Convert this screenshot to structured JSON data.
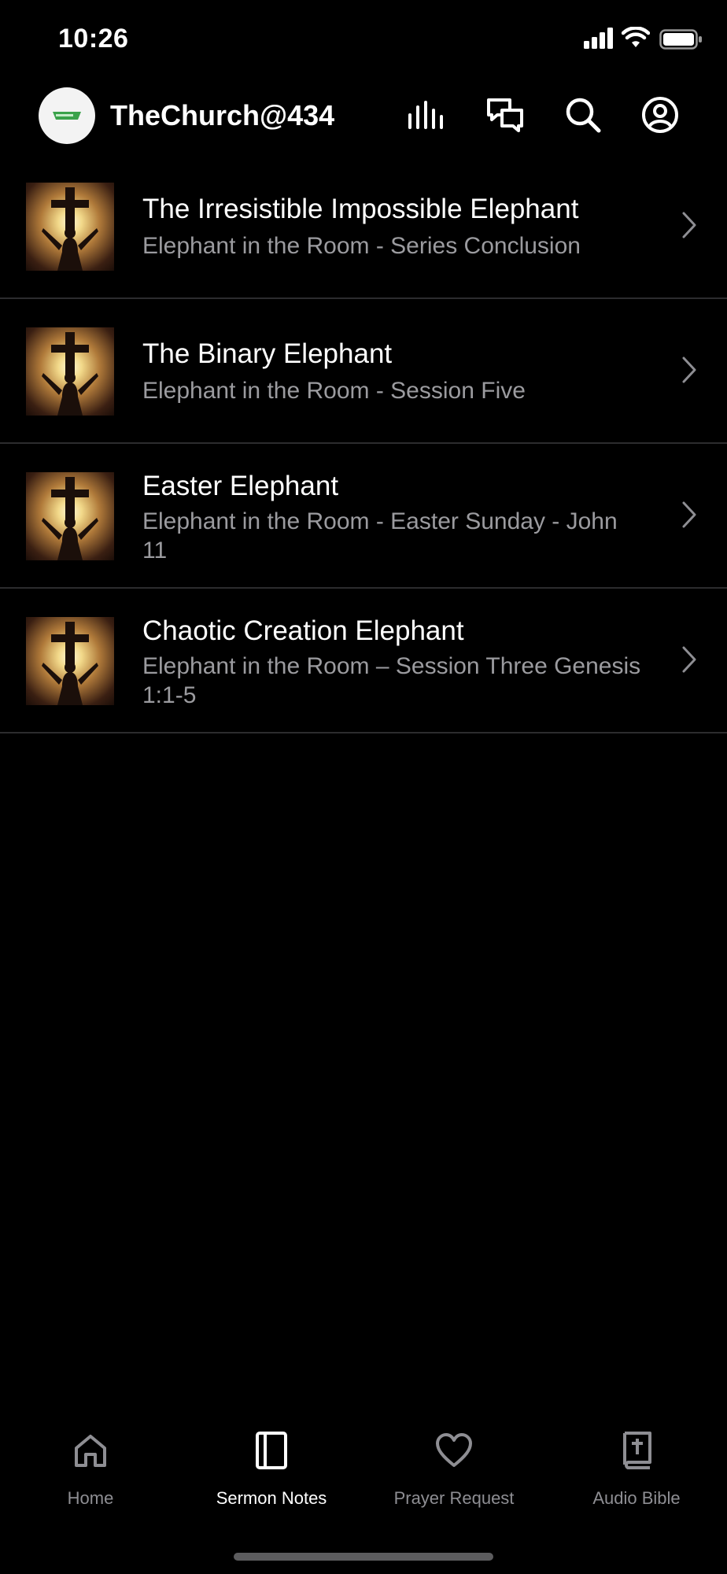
{
  "status_bar": {
    "time": "10:26"
  },
  "header": {
    "title": "TheChurch@434",
    "logo_text": "TheChurch@434",
    "icons": [
      "audio-levels-icon",
      "chat-bubbles-icon",
      "search-icon",
      "account-icon"
    ]
  },
  "sermons": [
    {
      "title": "The Irresistible Impossible Elephant",
      "subtitle": "Elephant in the Room - Series Conclusion"
    },
    {
      "title": "The Binary Elephant",
      "subtitle": "Elephant in the Room - Session Five"
    },
    {
      "title": "Easter Elephant",
      "subtitle": "Elephant in the Room - Easter Sunday - John 11"
    },
    {
      "title": "Chaotic Creation Elephant",
      "subtitle": "Elephant in the Room – Session Three Genesis 1:1-5"
    }
  ],
  "tabbar": {
    "tabs": [
      {
        "label": "Home",
        "icon": "home-icon",
        "active": false
      },
      {
        "label": "Sermon Notes",
        "icon": "notebook-icon",
        "active": true
      },
      {
        "label": "Prayer Request",
        "icon": "heart-icon",
        "active": false
      },
      {
        "label": "Audio Bible",
        "icon": "bible-icon",
        "active": false
      }
    ]
  },
  "colors": {
    "background": "#000000",
    "text_primary": "#ffffff",
    "text_secondary": "#9b9b9f",
    "divider": "#2c2c2e"
  }
}
